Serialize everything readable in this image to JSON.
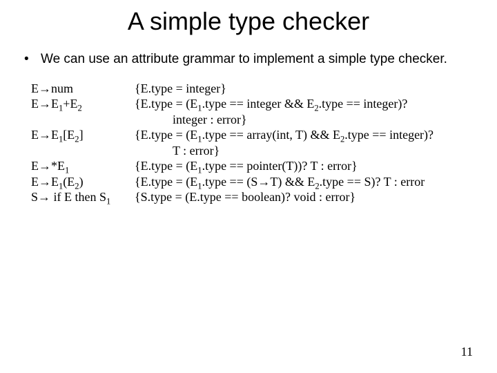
{
  "title": "A simple type checker",
  "bullet": {
    "dot": "•",
    "text": "We can use an attribute grammar to implement a simple type checker."
  },
  "rules": [
    {
      "prod": "E→num",
      "sem": "{E.type = integer}"
    },
    {
      "prod": "E→E₁+E₂",
      "sem": "{E.type = (E₁.type == integer && E₂.type == integer)?"
    },
    {
      "prod": "",
      "sem": "integer : error}",
      "cont": true
    },
    {
      "prod": "E→E₁[E₂]",
      "sem": "{E.type = (E₁.type == array(int, T) && E₂.type == integer)?"
    },
    {
      "prod": "",
      "sem": "T : error}",
      "cont": true
    },
    {
      "prod": "E→*E₁",
      "sem": "{E.type = (E₁.type == pointer(T))? T : error}"
    },
    {
      "prod": "E→E₁(E₂)",
      "sem": "{E.type = (E₁.type == (S→T) && E₂.type == S)? T : error"
    },
    {
      "prod": "S→ if E then S₁",
      "sem": "{S.type = (E.type == boolean)? void : error}"
    }
  ],
  "pagenum": "11"
}
